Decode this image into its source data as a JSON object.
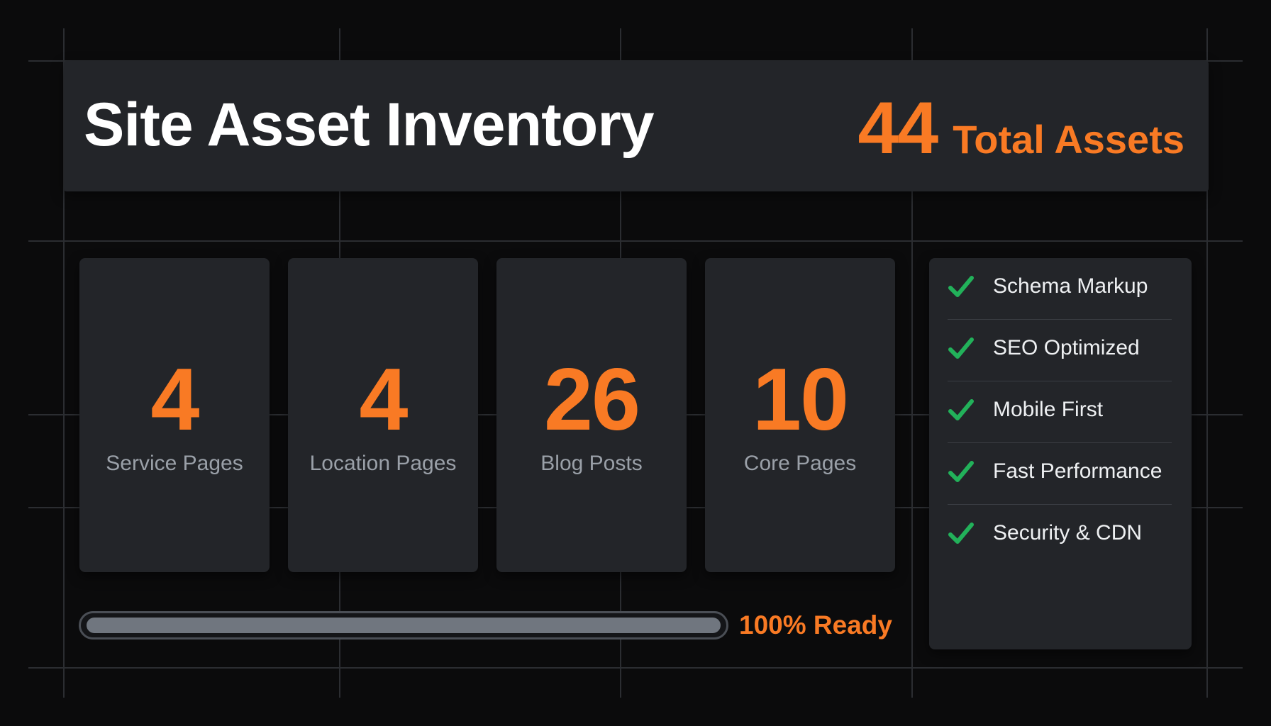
{
  "header": {
    "title": "Site Asset Inventory",
    "total_number": "44",
    "total_label": "Total Assets"
  },
  "cards": [
    {
      "value": "4",
      "label": "Service Pages"
    },
    {
      "value": "4",
      "label": "Location Pages"
    },
    {
      "value": "26",
      "label": "Blog Posts"
    },
    {
      "value": "10",
      "label": "Core Pages"
    }
  ],
  "progress": {
    "percent": 100,
    "label": "100% Ready"
  },
  "checklist": [
    {
      "icon": "check-icon",
      "label": "Schema Markup"
    },
    {
      "icon": "check-icon",
      "label": "SEO Optimized"
    },
    {
      "icon": "check-icon",
      "label": "Mobile First"
    },
    {
      "icon": "check-icon",
      "label": "Fast Performance"
    },
    {
      "icon": "check-icon",
      "label": "Security & CDN"
    }
  ],
  "colors": {
    "background": "#0b0b0c",
    "panel": "#232529",
    "accent": "#f97a24",
    "check": "#22b15a",
    "grid": "#2b2d31"
  }
}
